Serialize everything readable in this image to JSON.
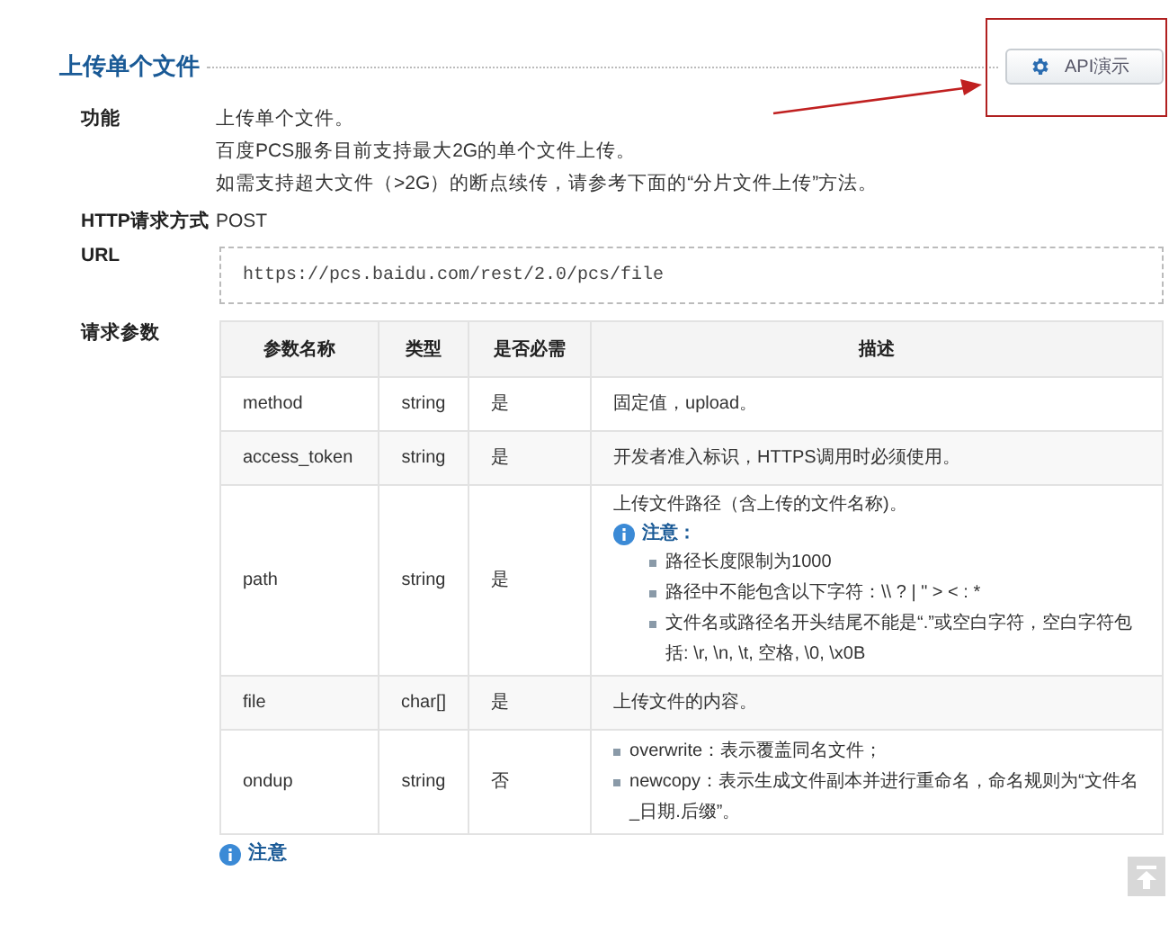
{
  "section_title": "上传单个文件",
  "demo_button": {
    "label": "API演示"
  },
  "fields": [
    {
      "label": "功能",
      "lines": [
        "上传单个文件。",
        "百度PCS服务目前支持最大2G的单个文件上传。",
        "如需支持超大文件（>2G）的断点续传，请参考下面的“分片文件上传”方法。"
      ]
    },
    {
      "label": "HTTP请求方式",
      "lines": [
        "POST"
      ]
    }
  ],
  "url": {
    "label": "URL",
    "value": "https://pcs.baidu.com/rest/2.0/pcs/file"
  },
  "params": {
    "label": "请求参数",
    "columns": [
      "参数名称",
      "类型",
      "是否必需",
      "描述"
    ],
    "rows": [
      {
        "name": "method",
        "type": "string",
        "required": "是",
        "description": "固定值，upload。"
      },
      {
        "name": "access_token",
        "type": "string",
        "required": "是",
        "description": "开发者准入标识，HTTPS调用时必须使用。"
      },
      {
        "name": "path",
        "type": "string",
        "required": "是",
        "description": "上传文件路径（含上传的文件名称)。",
        "note": "注意：",
        "bullets": [
          "路径长度限制为1000",
          "路径中不能包含以下字符：\\\\ ? | \" > < : *",
          "文件名或路径名开头结尾不能是“.”或空白字符，空白字符包括: \\r, \\n, \\t, 空格, \\0, \\x0B"
        ]
      },
      {
        "name": "file",
        "type": "char[]",
        "required": "是",
        "description": "上传文件的内容。"
      },
      {
        "name": "ondup",
        "type": "string",
        "required": "否",
        "bullets": [
          "overwrite：表示覆盖同名文件；",
          "newcopy：表示生成文件副本并进行重命名，命名规则为“文件名_日期.后缀”。"
        ]
      }
    ]
  },
  "footer_note": "注意"
}
